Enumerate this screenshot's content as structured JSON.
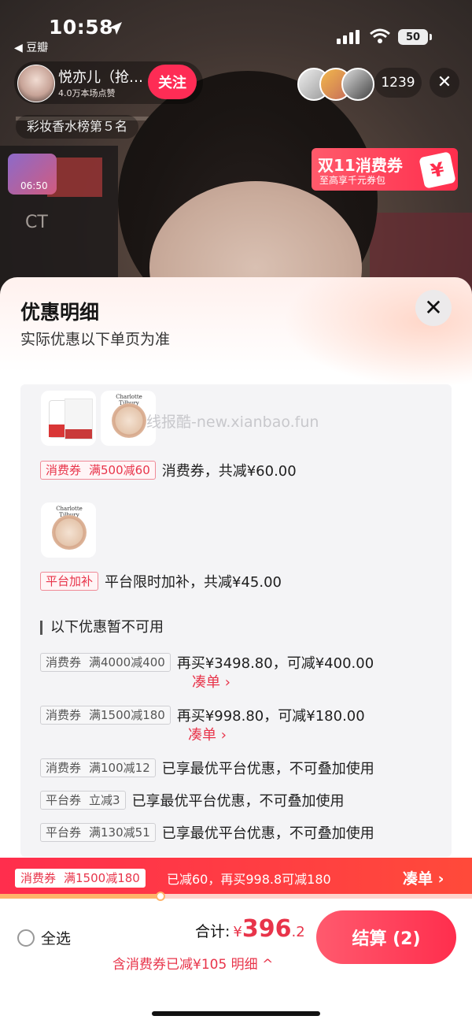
{
  "status_bar": {
    "time": "10:58",
    "back_app": "◀ 豆瓣",
    "battery": "50"
  },
  "live": {
    "host_name": "悦亦儿（抢…",
    "host_likes": "4.0万本场点赞",
    "follow_label": "关注",
    "viewer_count": "1239",
    "rank": "彩妆香水榜第５名",
    "thumb_time": "06:50",
    "promo_title": "双11消费券",
    "promo_sub": "至高享千元券包",
    "bg_text": "CT"
  },
  "sheet": {
    "title": "优惠明细",
    "subtitle": "实际优惠以下单页为准",
    "watermark": "线报酷-new.xianbao.fun",
    "applied": [
      {
        "tag": "消费券",
        "cond": "满500减60",
        "desc": "消费券，共减¥60.00"
      },
      {
        "tag": "平台加补",
        "cond": "",
        "desc": "平台限时加补，共减¥45.00"
      }
    ],
    "unavailable_title": "以下优惠暂不可用",
    "unavailable": [
      {
        "tag": "消费券",
        "cond": "满4000减400",
        "desc": "再买¥3498.80，可减¥400.00",
        "action": "凑单 ›"
      },
      {
        "tag": "消费券",
        "cond": "满1500减180",
        "desc": "再买¥998.80，可减¥180.00",
        "action": "凑单 ›"
      },
      {
        "tag": "消费券",
        "cond": "满100减12",
        "desc": "已享最优平台优惠，不可叠加使用",
        "action": ""
      },
      {
        "tag": "平台券",
        "cond": "立减3",
        "desc": "已享最优平台优惠，不可叠加使用",
        "action": ""
      },
      {
        "tag": "平台券",
        "cond": "满130减51",
        "desc": "已享最优平台优惠，不可叠加使用",
        "action": ""
      }
    ]
  },
  "promo_bar": {
    "tag": "消费券",
    "cond": "满1500减180",
    "text": "已减60，再买998.8可减180",
    "action": "凑单 ›",
    "progress_fraction": 0.34
  },
  "checkout": {
    "select_all": "全选",
    "total_label": "合计:",
    "currency": "¥",
    "amount_int": "396",
    "amount_dec": ".2",
    "savings": "含消费券已减¥105  明细 ^",
    "pay_label": "结算 (2)"
  },
  "colors": {
    "accent": "#e8344a",
    "pay_button": "#ff2e4d"
  }
}
